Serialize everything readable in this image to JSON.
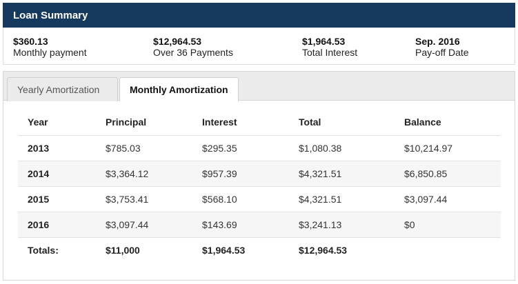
{
  "summary": {
    "title": "Loan Summary",
    "stats": [
      {
        "value": "$360.13",
        "label": "Monthly payment"
      },
      {
        "value": "$12,964.53",
        "label": "Over 36 Payments"
      },
      {
        "value": "$1,964.53",
        "label": "Total Interest"
      },
      {
        "value": "Sep. 2016",
        "label": "Pay-off Date"
      }
    ]
  },
  "tabs": [
    {
      "label": "Yearly Amortization",
      "active": true
    },
    {
      "label": "Monthly Amortization",
      "active": false
    }
  ],
  "table": {
    "headers": [
      "Year",
      "Principal",
      "Interest",
      "Total",
      "Balance"
    ],
    "rows": [
      [
        "2013",
        "$785.03",
        "$295.35",
        "$1,080.38",
        "$10,214.97"
      ],
      [
        "2014",
        "$3,364.12",
        "$957.39",
        "$4,321.51",
        "$6,850.85"
      ],
      [
        "2015",
        "$3,753.41",
        "$568.10",
        "$4,321.51",
        "$3,097.44"
      ],
      [
        "2016",
        "$3,097.44",
        "$143.69",
        "$3,241.13",
        "$0"
      ]
    ],
    "totals": [
      "Totals:",
      "$11,000",
      "$1,964.53",
      "$12,964.53",
      ""
    ]
  },
  "colors": {
    "header_bg": "#163a5e",
    "row_alt_bg": "#f6f6f6",
    "tabbar_bg": "#ebebeb"
  }
}
